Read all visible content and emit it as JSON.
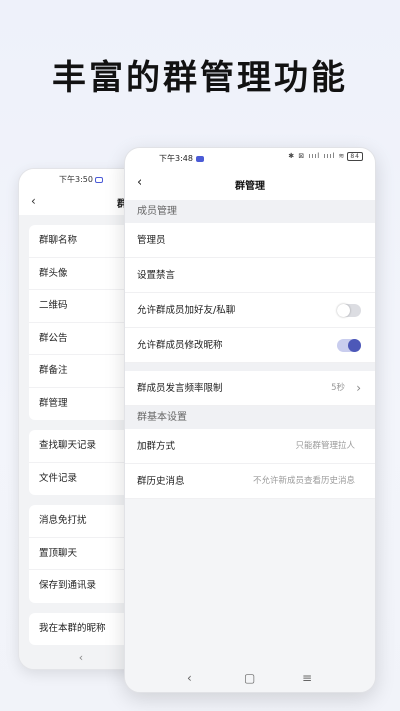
{
  "headline": "丰富的群管理功能",
  "back_phone": {
    "status_time": "下午3:50",
    "nav_title": "群",
    "groups": [
      [
        "群聊名称",
        "群头像",
        "二维码",
        "群公告",
        "群备注",
        "群管理"
      ],
      [
        "查找聊天记录",
        "文件记录"
      ],
      [
        "消息免打扰",
        "置顶聊天",
        "保存到通讯录"
      ],
      [
        "我在本群的昵称"
      ]
    ]
  },
  "front_phone": {
    "status_time": "下午3:48",
    "status_icons": "✱ ⊠ ıııl ıııl ≋",
    "battery": "84",
    "nav_title": "群管理",
    "section_member": "成员管理",
    "admin": "管理员",
    "mute": "设置禁言",
    "allow_friend": "允许群成员加好友/私聊",
    "allow_friend_on": false,
    "allow_nickname": "允许群成员修改昵称",
    "allow_nickname_on": true,
    "speak_rate_label": "群成员发言频率限制",
    "speak_rate_value": "5秒",
    "section_basic": "群基本设置",
    "join_label": "加群方式",
    "join_value": "只能群管理拉人",
    "history_label": "群历史消息",
    "history_value": "不允许新成员查看历史消息"
  },
  "colors": {
    "accent": "#4d58b8"
  }
}
